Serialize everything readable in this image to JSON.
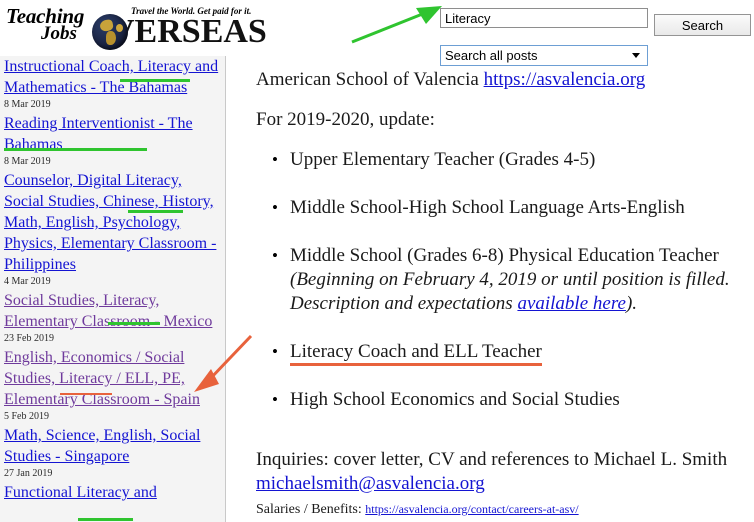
{
  "logo": {
    "teaching": "Teaching",
    "jobs": "Jobs",
    "tagline": "Travel the World. Get paid for it.",
    "overseas": "VERSEAS",
    "globe_icon": "globe-icon"
  },
  "search": {
    "query_value": "Literacy",
    "placeholder": "",
    "button_label": "Search",
    "scope_selected": "Search all posts",
    "scope_options": [
      "Search all posts"
    ],
    "caret_icon": "chevron-down-icon"
  },
  "sidebar": {
    "entries": [
      {
        "title": "Instructional Coach, Literacy and Mathematics - The Bahamas",
        "date": "8 Mar 2019",
        "visited": false
      },
      {
        "title": "Reading Interventionist - The Bahamas",
        "date": "8 Mar 2019",
        "visited": false
      },
      {
        "title": "Counselor, Digital Literacy, Social Studies, Chinese, History, Math, English, Psychology, Physics, Elementary Classroom - Philippines",
        "date": "4 Mar 2019",
        "visited": false
      },
      {
        "title": "Social Studies, Literacy, Elementary Classroom - Mexico",
        "date": "23 Feb 2019",
        "visited": true
      },
      {
        "title": "English, Economics / Social Studies, Literacy / ELL, PE, Elementary Classroom - Spain",
        "date": "5 Feb 2019",
        "visited": true
      },
      {
        "title": "Math, Science, English, Social Studies - Singapore",
        "date": "27 Jan 2019",
        "visited": false
      },
      {
        "title": "Functional Literacy and",
        "date": "",
        "visited": false
      }
    ]
  },
  "main": {
    "school_name": "American School of Valencia ",
    "school_url": "https://asvalencia.org",
    "update_line": "For 2019-2020, update:",
    "jobs": [
      {
        "text": "Upper Elementary Teacher (Grades 4-5)"
      },
      {
        "text": "Middle School-High School Language Arts-English"
      },
      {
        "text": "Middle School (Grades 6-8) Physical Education Teacher ",
        "italic_before": "(Beginning on February 4, 2019 or until position is filled. Description and expectations ",
        "link": "available here",
        "italic_after": ")."
      },
      {
        "text": "Literacy Coach and ELL Teacher",
        "underline": "red"
      },
      {
        "text": "High School Economics and Social Studies"
      }
    ],
    "inquiries_text": "Inquiries: cover letter, CV and references to Michael L. Smith ",
    "inquiries_email": "michaelsmith@asvalencia.org",
    "salaries_label": "Salaries / Benefits: ",
    "salaries_url": "https://asvalencia.org/contact/careers-at-asv/"
  },
  "annotations": {
    "green_arrow_color": "#2fc42f",
    "red_arrow_color": "#e8623c",
    "green_arrow_name": "green-annotation-arrow",
    "red_arrow_name": "red-annotation-arrow"
  }
}
